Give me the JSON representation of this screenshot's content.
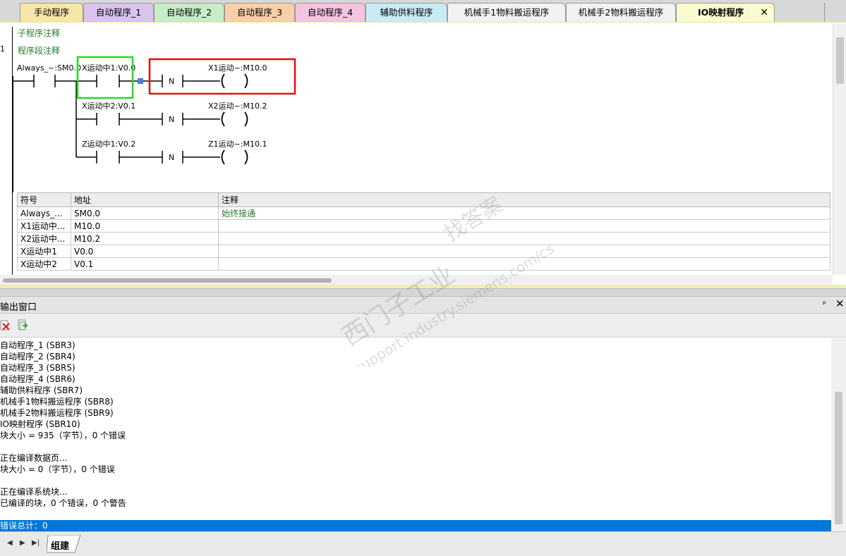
{
  "tabs": [
    {
      "label": "手动程序",
      "color": "#f6e6a8",
      "active": false
    },
    {
      "label": "自动程序_1",
      "color": "#d8c4ee",
      "active": false
    },
    {
      "label": "自动程序_2",
      "color": "#c8ecc8",
      "active": false
    },
    {
      "label": "自动程序_3",
      "color": "#f8cfa8",
      "active": false
    },
    {
      "label": "自动程序_4",
      "color": "#f4c4e0",
      "active": false
    },
    {
      "label": "辅助供料程序",
      "color": "#c8ecf6",
      "active": false
    },
    {
      "label": "机械手1物料搬运程序",
      "color": "#f2f2f2",
      "active": false
    },
    {
      "label": "机械手2物料搬运程序",
      "color": "#f2f2f2",
      "active": false
    },
    {
      "label": "IO映射程序",
      "color": "#fbfbd0",
      "active": true
    }
  ],
  "tab_close_glyph": "✕",
  "editor": {
    "subroutine_comment": "子程序注释",
    "network_comment": "程序段注释",
    "network_number": "1"
  },
  "ladder": {
    "contact_always": "Always_~:SM0.0",
    "branches": [
      {
        "contact": "X运动中1:V0.0",
        "coil": "X1运动~:M10.0"
      },
      {
        "contact": "X运动中2:V0.1",
        "coil": "X2运动~:M10.2"
      },
      {
        "contact": "Z运动中1:V0.2",
        "coil": "Z1运动~:M10.1"
      }
    ],
    "not_label": "N"
  },
  "symbol_table": {
    "headers": [
      "符号",
      "地址",
      "注释"
    ],
    "rows": [
      [
        "Always_...",
        "SM0.0",
        "始终接通"
      ],
      [
        "X1运动中...",
        "M10.0",
        ""
      ],
      [
        "X2运动中...",
        "M10.2",
        ""
      ],
      [
        "X运动中1",
        "V0.0",
        ""
      ],
      [
        "X运动中2",
        "V0.1",
        ""
      ]
    ]
  },
  "output": {
    "title": "输出窗口",
    "pin_glyph": "ᵖ",
    "close_glyph": "✕",
    "lines": [
      "自动程序_1 (SBR3)",
      "自动程序_2 (SBR4)",
      "自动程序_3 (SBR5)",
      "自动程序_4 (SBR6)",
      "辅助供料程序 (SBR7)",
      "机械手1物料搬运程序 (SBR8)",
      "机械手2物料搬运程序 (SBR9)",
      "IO映射程序 (SBR10)",
      "块大小 = 935（字节），0 个错误",
      "",
      "正在编译数据页...",
      "块大小 = 0（字节），0 个错误",
      "",
      "正在编译系统块...",
      "已编译的块，0 个错误，0 个警告",
      ""
    ],
    "status_line": "错误总计：0"
  },
  "bottom_tab": {
    "label": "组建"
  },
  "watermark": {
    "line1": "西门子工业",
    "line2": "找答案",
    "line3": "support.industry.siemens.com/cs"
  }
}
